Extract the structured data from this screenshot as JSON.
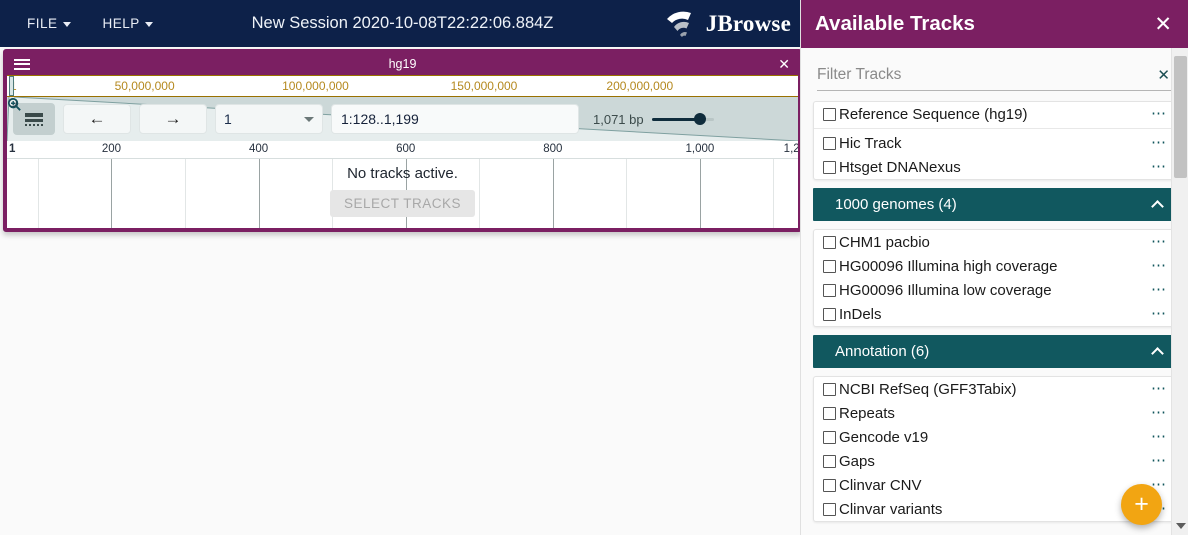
{
  "appbar": {
    "menus": [
      {
        "label": "FILE",
        "icon": "caret-down-icon"
      },
      {
        "label": "HELP",
        "icon": "caret-down-icon"
      }
    ],
    "session_title": "New Session 2020-10-08T22:22:06.884Z",
    "brand": "JBrowse",
    "brand_icon": "jbrowse-arc-logo-icon",
    "bg_color": "#0d2149"
  },
  "view": {
    "titlebar": {
      "menu_icon": "hamburger-icon",
      "title": "hg19",
      "close_icon": "close-icon",
      "bg_color": "#7b1f62"
    },
    "overview_ruler": {
      "start_label": "1",
      "ticks": [
        {
          "label": "50,000,000",
          "pos_pct": 17.4
        },
        {
          "label": "100,000,000",
          "pos_pct": 39.0
        },
        {
          "label": "150,000,000",
          "pos_pct": 60.3
        },
        {
          "label": "200,000,000",
          "pos_pct": 80.0
        }
      ],
      "tick_color": "#b5891f"
    },
    "navbar": {
      "track_selector_icon": "track-selector-icon",
      "back_icon": "arrow-left-icon",
      "forward_icon": "arrow-right-icon",
      "refseq_value": "1",
      "refseq_caret_icon": "caret-down-icon",
      "location_search_icon": "search-icon",
      "location_value": "1:128..1,199",
      "bp_label": "1,071 bp",
      "zoom_out_icon": "zoom-out-icon",
      "zoom_in_icon": "zoom-in-icon",
      "zoom_value_pct": 70
    },
    "scale_ruler": {
      "start_label": "1",
      "ticks": [
        {
          "label": "200",
          "pos_pct": 13.2
        },
        {
          "label": "400",
          "pos_pct": 31.8
        },
        {
          "label": "600",
          "pos_pct": 50.4
        },
        {
          "label": "800",
          "pos_pct": 69.0
        },
        {
          "label": "1,000",
          "pos_pct": 87.6
        },
        {
          "label": "1,2",
          "pos_pct": 99.2
        }
      ]
    },
    "empty_state": {
      "message": "No tracks active.",
      "button_label": "SELECT TRACKS"
    }
  },
  "drawer": {
    "title": "Available Tracks",
    "close_icon": "close-icon",
    "header_color": "#7b1f62",
    "filter": {
      "placeholder": "Filter Tracks",
      "value": "",
      "clear_icon": "close-icon"
    },
    "standalone_tracks_top": [
      {
        "label": "Reference Sequence (hg19)",
        "checked": false,
        "menu_icon": "more-options-icon"
      }
    ],
    "standalone_tracks_mid": [
      {
        "label": "Hic Track",
        "checked": false,
        "menu_icon": "more-options-icon"
      },
      {
        "label": "Htsget DNANexus",
        "checked": false,
        "menu_icon": "more-options-icon"
      }
    ],
    "categories": [
      {
        "title": "1000 genomes (4)",
        "expanded": true,
        "chevron_icon": "chevron-up-icon",
        "tracks": [
          {
            "label": "CHM1 pacbio",
            "checked": false,
            "menu_icon": "more-options-icon"
          },
          {
            "label": "HG00096 Illumina high coverage",
            "checked": false,
            "menu_icon": "more-options-icon"
          },
          {
            "label": "HG00096 Illumina low coverage",
            "checked": false,
            "menu_icon": "more-options-icon"
          },
          {
            "label": "InDels",
            "checked": false,
            "menu_icon": "more-options-icon"
          }
        ]
      },
      {
        "title": "Annotation (6)",
        "expanded": true,
        "chevron_icon": "chevron-up-icon",
        "tracks": [
          {
            "label": "NCBI RefSeq (GFF3Tabix)",
            "checked": false,
            "menu_icon": "more-options-icon"
          },
          {
            "label": "Repeats",
            "checked": false,
            "menu_icon": "more-options-icon"
          },
          {
            "label": "Gencode v19",
            "checked": false,
            "menu_icon": "more-options-icon"
          },
          {
            "label": "Gaps",
            "checked": false,
            "menu_icon": "more-options-icon"
          },
          {
            "label": "Clinvar CNV",
            "checked": false,
            "menu_icon": "more-options-icon"
          },
          {
            "label": "Clinvar variants",
            "checked": false,
            "menu_icon": "more-options-icon"
          }
        ]
      }
    ],
    "category_color": "#11585f",
    "add_track_fab": {
      "label": "+",
      "icon": "plus-icon",
      "color": "#f2a512"
    },
    "scrollbar": {
      "down_arrow_icon": "chevron-down-icon"
    }
  }
}
